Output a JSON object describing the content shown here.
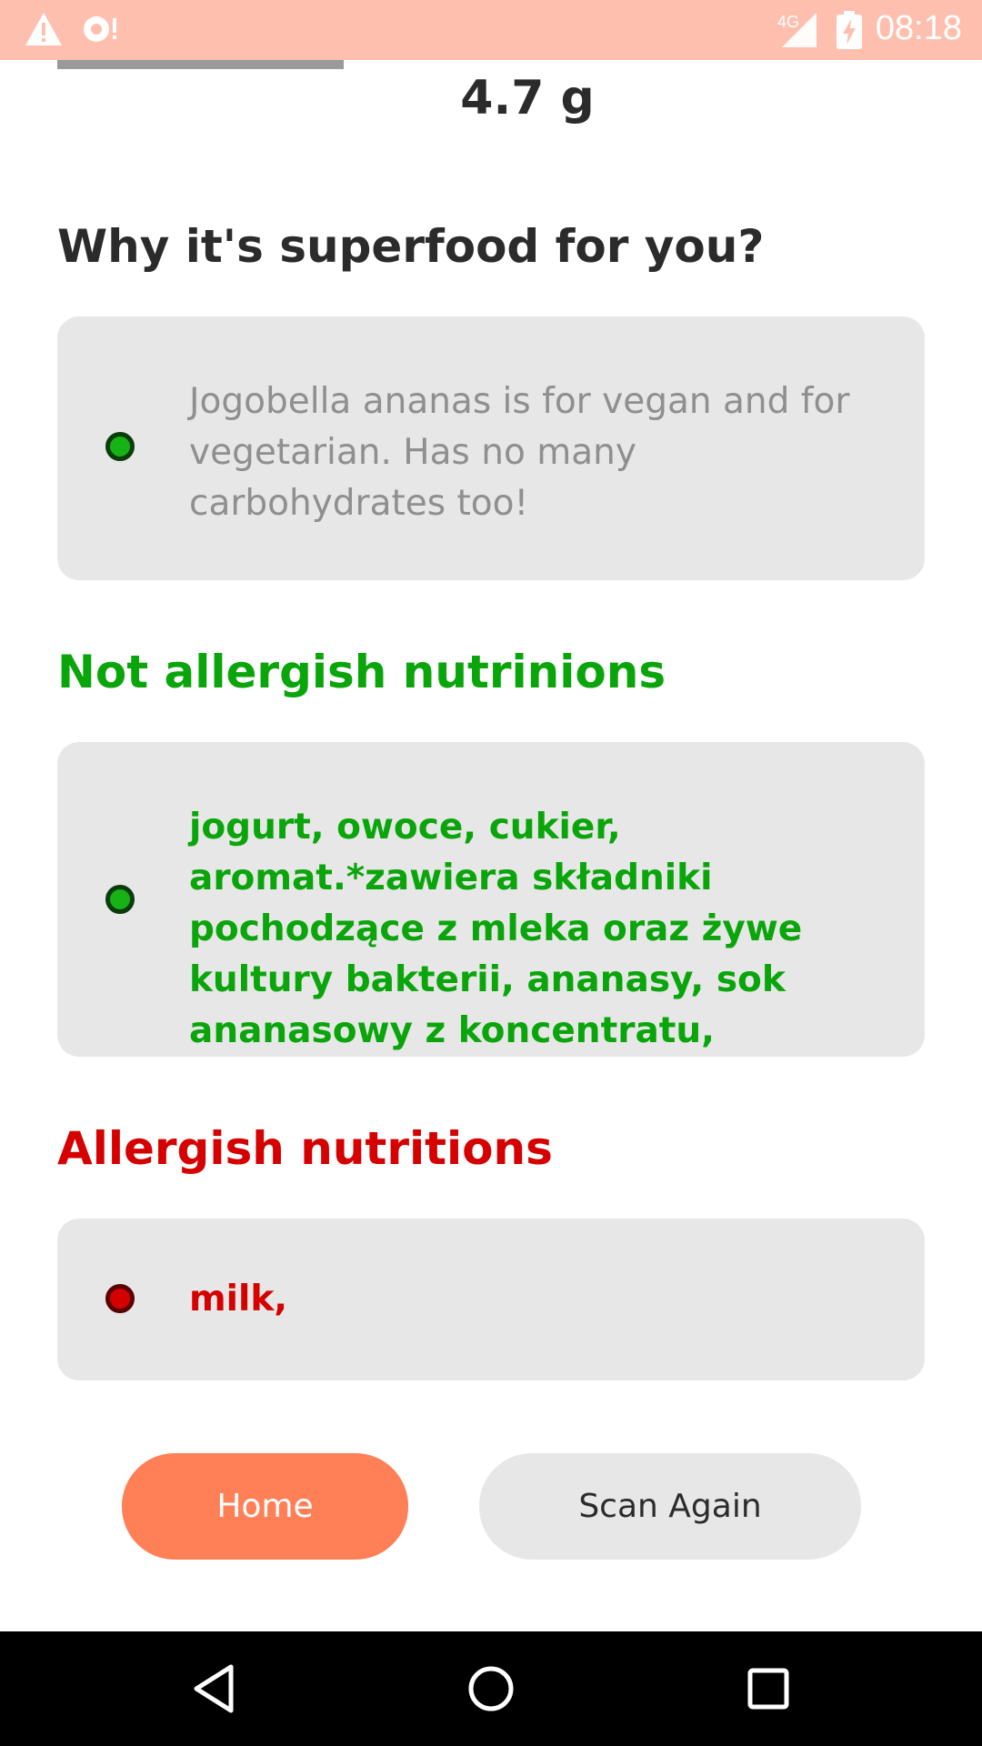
{
  "status_bar": {
    "time": "08:18",
    "network": "4G",
    "icons": [
      "warning-icon",
      "sync-alert-icon",
      "signal-icon",
      "battery-charging-icon"
    ],
    "background": "#ffbfae"
  },
  "product": {
    "value": "4.7 g"
  },
  "superfood": {
    "title": "Why it's superfood for you?",
    "text": "Jogobella ananas is for vegan and for vegetarian. Has no many carbohydrates too!"
  },
  "not_allergens": {
    "title": "Not allergish nutrinions",
    "text": "jogurt, owoce, cukier, aromat.*zawiera składniki pochodzące z mleka oraz żywe kultury bakterii, ananasy, sok ananasowy z koncentratu,",
    "color": "#0aa50a"
  },
  "allergens": {
    "title": "Allergish nutritions",
    "text": "milk,",
    "color": "#d50000"
  },
  "actions": {
    "home_label": "Home",
    "scan_again_label": "Scan Again",
    "accent": "#ff7f57"
  },
  "nav_bar": {
    "icons": [
      "back-icon",
      "home-circle-icon",
      "recents-icon"
    ]
  }
}
